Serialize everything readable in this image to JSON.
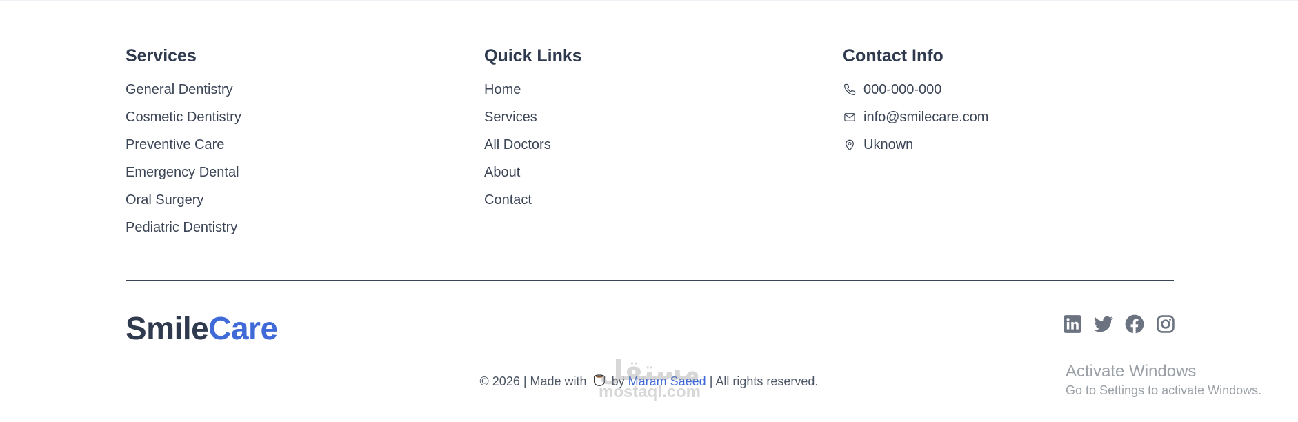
{
  "services": {
    "heading": "Services",
    "items": [
      "General Dentistry",
      "Cosmetic Dentistry",
      "Preventive Care",
      "Emergency Dental",
      "Oral Surgery",
      "Pediatric Dentistry"
    ]
  },
  "quick_links": {
    "heading": "Quick Links",
    "items": [
      "Home",
      "Services",
      "All Doctors",
      "About",
      "Contact"
    ]
  },
  "contact": {
    "heading": "Contact Info",
    "phone": "000-000-000",
    "email": "info@smilecare.com",
    "address": "Uknown"
  },
  "brand": {
    "part1": "Smile",
    "part2": "Care",
    "color_dark": "#2f3a4e",
    "color_accent": "#3f6ad8"
  },
  "social": [
    "linkedin-icon",
    "twitter-icon",
    "facebook-icon",
    "instagram-icon"
  ],
  "footer": {
    "prefix": "© 2026 | Made with",
    "by": "by",
    "author": "Maram Saeed",
    "suffix": "| All rights reserved."
  },
  "watermark": {
    "glyphs": "مستقل",
    "text": "mostaql.com"
  },
  "system_overlay": {
    "title": "Activate Windows",
    "subtitle": "Go to Settings to activate Windows."
  }
}
